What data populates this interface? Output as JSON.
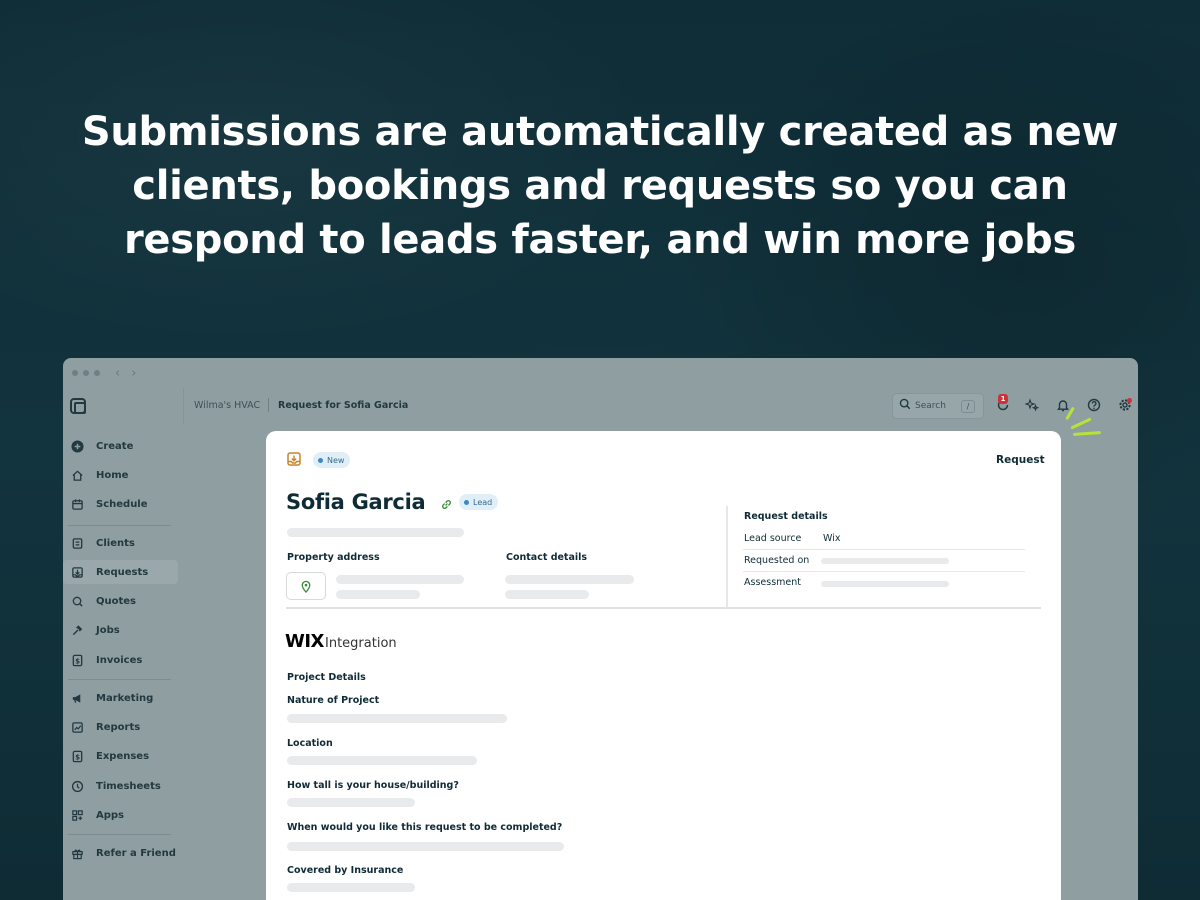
{
  "headline": "Submissions are automatically created as new clients, bookings and requests so you can respond to leads faster, and win more jobs",
  "window": {
    "breadcrumb": {
      "company": "Wilma's HVAC",
      "page": "Request for Sofia Garcia"
    },
    "search": {
      "label": "Search",
      "shortcut": "/"
    },
    "notification_count": "1",
    "sidebar": [
      {
        "label": "Create",
        "icon": "plus-circle-icon"
      },
      {
        "label": "Home",
        "icon": "home-icon"
      },
      {
        "label": "Schedule",
        "icon": "calendar-icon"
      },
      {
        "label": "Clients",
        "icon": "clients-icon"
      },
      {
        "label": "Requests",
        "icon": "inbox-download-icon",
        "active": true
      },
      {
        "label": "Quotes",
        "icon": "quotes-icon"
      },
      {
        "label": "Jobs",
        "icon": "hammer-icon"
      },
      {
        "label": "Invoices",
        "icon": "dollar-icon"
      },
      {
        "label": "Marketing",
        "icon": "megaphone-icon"
      },
      {
        "label": "Reports",
        "icon": "chart-icon"
      },
      {
        "label": "Expenses",
        "icon": "dollar-icon"
      },
      {
        "label": "Timesheets",
        "icon": "clock-icon"
      },
      {
        "label": "Apps",
        "icon": "apps-icon"
      },
      {
        "label": "Refer a Friend",
        "icon": "gift-icon"
      }
    ]
  },
  "request": {
    "status_pill": "New",
    "header_title": "Request",
    "client_name": "Sofia Garcia",
    "client_tag": "Lead",
    "property_address_label": "Property address",
    "contact_details_label": "Contact details",
    "details": {
      "title": "Request details",
      "lead_source_label": "Lead source",
      "lead_source_value": "Wix",
      "requested_on_label": "Requested on",
      "assessment_label": "Assessment"
    },
    "integration": {
      "brand": "WIX",
      "label": "Integration"
    },
    "project": {
      "section_title": "Project Details",
      "fields": [
        "Nature of Project",
        "Location",
        "How tall is your house/building?",
        "When would you like this request to be completed?",
        "Covered by Insurance"
      ]
    }
  },
  "colors": {
    "background": "#10303a",
    "accent": "#b6e33a",
    "badge": "#d0303a"
  }
}
